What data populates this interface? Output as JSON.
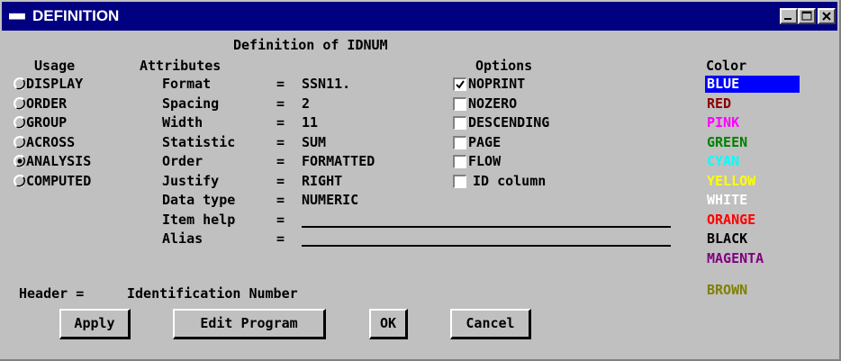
{
  "window": {
    "title": "DEFINITION",
    "system_icon": "sas-icon"
  },
  "dialog": {
    "heading": "Definition of IDNUM"
  },
  "usage": {
    "label": "Usage",
    "options": [
      "DISPLAY",
      "ORDER",
      "GROUP",
      "ACROSS",
      "ANALYSIS",
      "COMPUTED"
    ],
    "selected": "ANALYSIS"
  },
  "attributes": {
    "label": "Attributes",
    "rows": [
      {
        "name": "Format",
        "value": "SSN11."
      },
      {
        "name": "Spacing",
        "value": "2"
      },
      {
        "name": "Width",
        "value": "11"
      },
      {
        "name": "Statistic",
        "value": "SUM"
      },
      {
        "name": "Order",
        "value": "FORMATTED"
      },
      {
        "name": "Justify",
        "value": "RIGHT"
      },
      {
        "name": "Data type",
        "value": "NUMERIC"
      },
      {
        "name": "Item help",
        "value": ""
      },
      {
        "name": "Alias",
        "value": ""
      }
    ]
  },
  "options": {
    "label": "Options",
    "items": [
      {
        "label": "NOPRINT",
        "checked": true
      },
      {
        "label": "NOZERO",
        "checked": false
      },
      {
        "label": "DESCENDING",
        "checked": false
      },
      {
        "label": "PAGE",
        "checked": false
      },
      {
        "label": "FLOW",
        "checked": false
      },
      {
        "label": "ID column",
        "checked": false
      }
    ]
  },
  "color": {
    "label": "Color",
    "selected": "BLUE",
    "items": [
      {
        "label": "BLUE",
        "hex": "#ffffff"
      },
      {
        "label": "RED",
        "hex": "#8b0000"
      },
      {
        "label": "PINK",
        "hex": "#ff00ff"
      },
      {
        "label": "GREEN",
        "hex": "#008000"
      },
      {
        "label": "CYAN",
        "hex": "#00ffff"
      },
      {
        "label": "YELLOW",
        "hex": "#ffff00"
      },
      {
        "label": "WHITE",
        "hex": "#ffffff"
      },
      {
        "label": "ORANGE",
        "hex": "#ff0000"
      },
      {
        "label": "BLACK",
        "hex": "#000000"
      },
      {
        "label": "MAGENTA",
        "hex": "#800080"
      },
      {
        "label": "BROWN",
        "hex": "#808000"
      }
    ]
  },
  "header": {
    "label": "Header",
    "value": "Identification Number"
  },
  "buttons": {
    "apply": "Apply",
    "edit_program": "Edit Program",
    "ok": "OK",
    "cancel": "Cancel"
  }
}
